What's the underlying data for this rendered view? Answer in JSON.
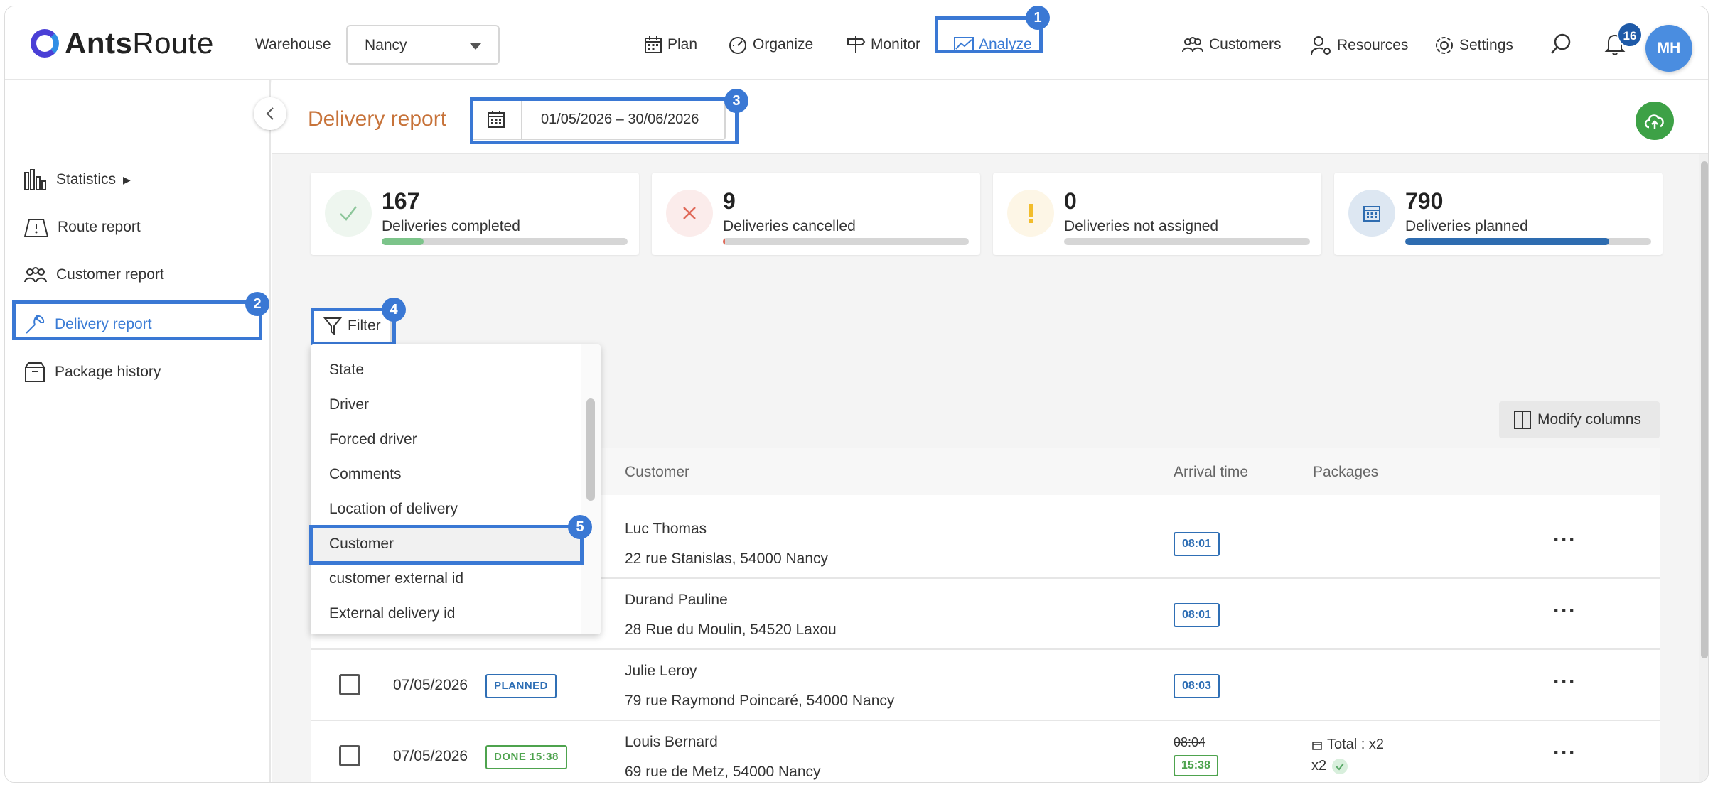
{
  "app": {
    "name_bold": "Ants",
    "name_light": "Route"
  },
  "header": {
    "warehouse_label": "Warehouse",
    "warehouse_value": "Nancy",
    "nav": {
      "plan": "Plan",
      "organize": "Organize",
      "monitor": "Monitor",
      "analyze": "Analyze",
      "customers": "Customers",
      "resources": "Resources",
      "settings": "Settings"
    },
    "notifications_count": "16",
    "avatar_initials": "MH"
  },
  "steps": [
    "1",
    "2",
    "3",
    "4",
    "5"
  ],
  "sidebar": {
    "items": [
      {
        "label": "Statistics",
        "suffix": "▶",
        "icon": "bar-chart-icon"
      },
      {
        "label": "Route report",
        "icon": "map-icon"
      },
      {
        "label": "Customer report",
        "icon": "people-icon"
      },
      {
        "label": "Delivery report",
        "icon": "wrench-icon"
      },
      {
        "label": "Package history",
        "icon": "package-icon"
      }
    ]
  },
  "page": {
    "title": "Delivery report",
    "date_range": "01/05/2026 – 30/06/2026"
  },
  "stats": [
    {
      "value": "167",
      "label": "Deliveries completed",
      "fill": 0.17,
      "color": "#7cc48a",
      "icon": "check-icon"
    },
    {
      "value": "9",
      "label": "Deliveries cancelled",
      "fill": 0.01,
      "color": "#e06a5a",
      "icon": "x-icon"
    },
    {
      "value": "0",
      "label": "Deliveries not assigned",
      "fill": 0.0,
      "color": "#f0b400",
      "icon": "exclamation-icon"
    },
    {
      "value": "790",
      "label": "Deliveries planned",
      "fill": 0.83,
      "color": "#2e6cb0",
      "icon": "calendar-icon"
    }
  ],
  "toolbar": {
    "filter_label": "Filter",
    "modify_columns_label": "Modify columns"
  },
  "filter_options": [
    "State",
    "Driver",
    "Forced driver",
    "Comments",
    "Location of delivery",
    "Customer",
    "customer external id",
    "External delivery id"
  ],
  "filter_selected": "Customer",
  "table": {
    "headers": {
      "customer": "Customer",
      "arrival": "Arrival time",
      "packages": "Packages"
    },
    "rows": [
      {
        "date": "",
        "status": "",
        "customer": "Luc Thomas",
        "address": "22 rue Stanislas, 54000 Nancy",
        "arrival": "08:01"
      },
      {
        "date": "",
        "status": "",
        "customer": "Durand Pauline",
        "address": "28 Rue du Moulin, 54520 Laxou",
        "arrival": "08:01"
      },
      {
        "date": "07/05/2026",
        "status": "PLANNED",
        "customer": "Julie Leroy",
        "address": "79 rue Raymond Poincaré, 54000 Nancy",
        "arrival": "08:03"
      },
      {
        "date": "07/05/2026",
        "status": "DONE 15:38",
        "customer": "Louis Bernard",
        "address": "69 rue de Metz, 54000 Nancy",
        "arrival_planned": "08:04",
        "arrival_actual": "15:38",
        "packages_total": "Total : x2",
        "packages_count": "x2"
      }
    ]
  },
  "colors": {
    "accent": "#3a78d4",
    "title": "#c7733a",
    "done": "#4ea34e",
    "planned": "#2f6fb5"
  }
}
